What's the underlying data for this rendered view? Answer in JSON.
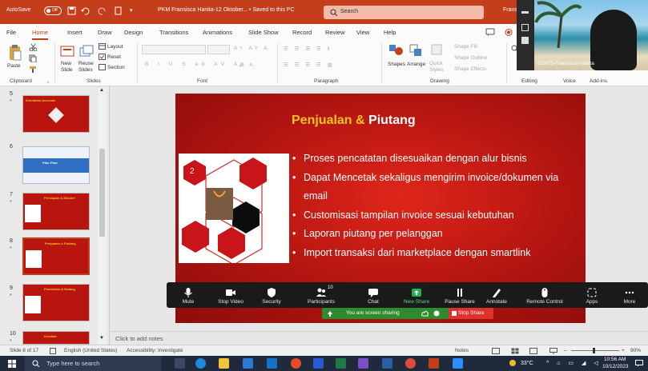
{
  "titlebar": {
    "autosave_label": "AutoSave",
    "autosave_state": "Off",
    "doc_title": "PKM Fransisca Hanita-12 Oktober... • Saved to this PC",
    "search_placeholder": "Search",
    "user_label": "Fransi"
  },
  "menu": {
    "tabs": [
      "File",
      "Home",
      "Insert",
      "Draw",
      "Design",
      "Transitions",
      "Animations",
      "Slide Show",
      "Record",
      "Review",
      "View",
      "Help"
    ]
  },
  "ribbon": {
    "paste": "Paste",
    "new_slide": "New\nSlide",
    "reuse_slides": "Reuse\nSlides",
    "layout": "Layout",
    "reset": "Reset",
    "section": "Section",
    "shapes": "Shapes",
    "arrange": "Arrange",
    "quick_styles": "Quick\nStyles",
    "shape_fill": "Shape Fill",
    "shape_outline": "Shape Outline",
    "shape_effects": "Shape Effects",
    "groups": {
      "clipboard": "Clipboard",
      "slides": "Slides",
      "font": "Font",
      "paragraph": "Paragraph",
      "drawing": "Drawing",
      "editing": "Editing",
      "voice": "Voice",
      "addins": "Add-ins"
    }
  },
  "slides_panel": {
    "numbers": [
      "5",
      "6",
      "7",
      "8",
      "9",
      "10"
    ],
    "thumb_titles": [
      "Kelebihan Accurate",
      "Fitur Fitur",
      "Persiapan & Stocker",
      "Penjualan & Piutang",
      "Pembelian & Hutang",
      "Kendala"
    ]
  },
  "slide": {
    "title_part1": "Penjualan & ",
    "title_part2": "Piutang",
    "hex_number": "2",
    "bullets": [
      "Proses pencatatan disesuaikan dengan alur bisnis",
      "Dapat Mencetak sekaligus mengirim invoice/dokumen via email",
      "Customisasi tampilan invoice sesuai kebutuhan",
      "Laporan piutang per pelanggan",
      "Import transaksi dari marketplace dengan smartlink"
    ]
  },
  "notes_placeholder": "Click to add notes",
  "zoom_toolbar": {
    "participants_count": "10",
    "items": [
      "Mute",
      "Stop Video",
      "Security",
      "Participants",
      "Chat",
      "New Share",
      "Pause Share",
      "Annotate",
      "Remote Control",
      "Apps",
      "More"
    ]
  },
  "share_bar": {
    "status": "You are screen sharing",
    "stop_label": "Stop Share"
  },
  "video": {
    "participant_name": "DS875-Fransisca Hanita"
  },
  "statusbar": {
    "slide_of": "Slide 8 of 17",
    "language": "English (United States)",
    "accessibility": "Accessibility: Investigate",
    "notes_btn": "Notes",
    "zoom_level": "90%"
  },
  "taskbar": {
    "search_placeholder": "Type here to search",
    "temperature": "33°C",
    "time": "10:56 AM",
    "date": "10/12/2023"
  },
  "colors": {
    "accent": "#c43e1c",
    "slide_title_yellow": "#f5c518",
    "zoom_green": "#2e8b2e",
    "stop_red": "#e0322d"
  }
}
